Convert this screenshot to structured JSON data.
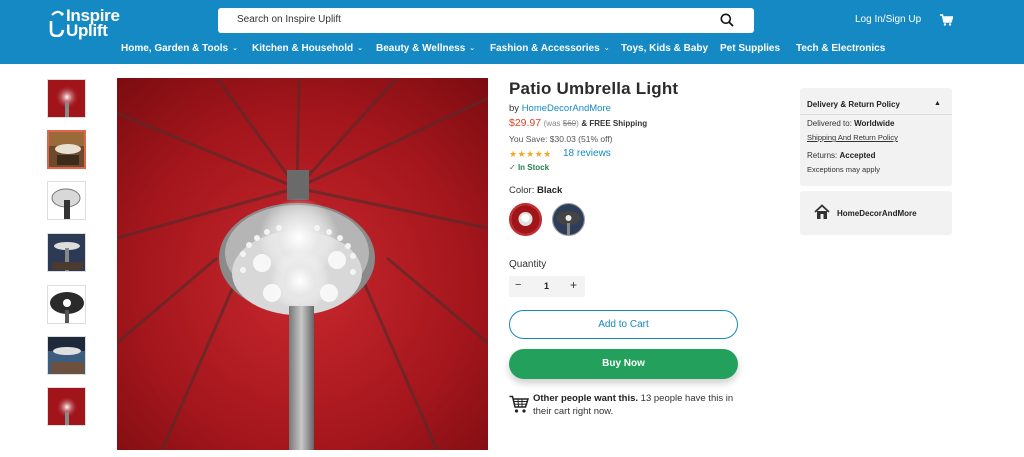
{
  "header": {
    "logo_line1": "Inspire",
    "logo_line2": "Uplift",
    "search_placeholder": "Search on Inspire Uplift",
    "login": "Log In/Sign Up",
    "brand_color": "#1589c4"
  },
  "nav": [
    {
      "label": "Home, Garden & Tools",
      "dropdown": true
    },
    {
      "label": "Kitchen & Household",
      "dropdown": true
    },
    {
      "label": "Beauty & Wellness",
      "dropdown": true
    },
    {
      "label": "Fashion & Accessories",
      "dropdown": true
    },
    {
      "label": "Toys, Kids & Baby",
      "dropdown": false
    },
    {
      "label": "Pet Supplies",
      "dropdown": false
    },
    {
      "label": "Tech & Electronics",
      "dropdown": false
    }
  ],
  "gallery": {
    "thumbnail_count": 7,
    "active_index": 1
  },
  "product": {
    "title": "Patio Umbrella Light",
    "by": "by",
    "seller": "HomeDecorAndMore",
    "price": "$29.97",
    "was_prefix": "(was ",
    "was_price": "$60",
    "was_suffix": ")",
    "shipping": "& FREE Shipping",
    "savings": "You Save: $30.03 (51% off)",
    "stars": "★★★★★",
    "rating": 5,
    "reviews": "18 reviews",
    "stock": "In Stock",
    "color_label": "Color: ",
    "color_value": "Black",
    "quantity_label": "Quantity",
    "quantity": "1",
    "minus": "−",
    "plus": "+",
    "add_to_cart": "Add to Cart",
    "buy_now": "Buy Now",
    "social_bold": "Other people want this.",
    "social_rest": " 13 people have this in their cart right now."
  },
  "delivery_panel": {
    "title": "Delivery & Return Policy",
    "delivered_label": "Delivered to: ",
    "delivered_value": "Worldwide",
    "policy_link": "Shipping And Return Policy",
    "returns_label": "Returns: ",
    "returns_value": "Accepted",
    "exceptions": "Exceptions may apply"
  },
  "store": {
    "name": "HomeDecorAndMore"
  },
  "colors": {
    "price": "#d9452b",
    "buy_button": "#23a05b",
    "stars": "#f5a623",
    "link": "#1589c4"
  }
}
